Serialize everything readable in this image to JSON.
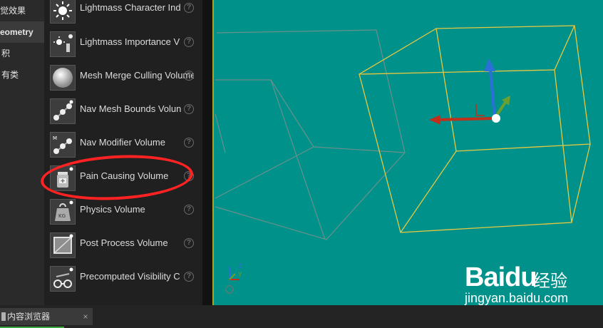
{
  "categories": {
    "items": [
      {
        "label": "觉效果"
      },
      {
        "label": "eometry"
      },
      {
        "label": "积"
      },
      {
        "label": "有类"
      }
    ]
  },
  "volumes": {
    "items": [
      {
        "label": "Lightmass Character Ind",
        "icon": "lightbulb-icon"
      },
      {
        "label": "Lightmass Importance V",
        "icon": "lightbulb-small-icon"
      },
      {
        "label": "Mesh Merge Culling Volume",
        "icon": "sphere-icon"
      },
      {
        "label": "Nav Mesh Bounds Volun",
        "icon": "nav-nodes-icon"
      },
      {
        "label": "Nav Modifier Volume",
        "icon": "nav-modifier-icon"
      },
      {
        "label": "Pain Causing Volume",
        "icon": "medicine-bottle-icon"
      },
      {
        "label": "Physics Volume",
        "icon": "weight-icon"
      },
      {
        "label": "Post Process Volume",
        "icon": "post-process-icon"
      },
      {
        "label": "Precomputed Visibility C",
        "icon": "glasses-icon"
      }
    ],
    "help_glyph": "?"
  },
  "viewport": {
    "axis_labels": {
      "z": "Z",
      "y": "Y"
    },
    "watermark": {
      "logo": "Baidu",
      "text": "经验",
      "url": "jingyan.baidu.com"
    }
  },
  "bottom_bar": {
    "tab_label": "内容浏览器",
    "close_glyph": "×"
  },
  "colors": {
    "viewport_bg": "#00928a",
    "selected_box": "#e8c840",
    "highlight_ring": "#ff2222",
    "gizmo_x": "#c0301a",
    "gizmo_y": "#6aa030",
    "gizmo_z": "#2c6fd8"
  }
}
